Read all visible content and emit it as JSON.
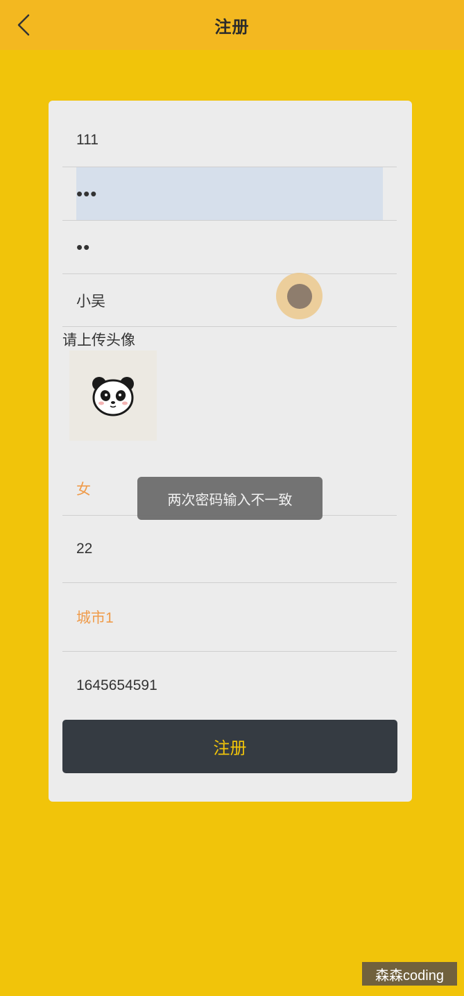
{
  "header": {
    "title": "注册",
    "back_icon": "chevron-left-icon"
  },
  "form": {
    "username": "111",
    "password": "•••",
    "confirm_password": "••",
    "nickname": "小吴",
    "avatar_label": "请上传头像",
    "avatar_icon": "panda-avatar-icon",
    "gender": "女",
    "age": "22",
    "city": "城市1",
    "phone": "1645654591",
    "submit_label": "注册"
  },
  "toast": {
    "message": "两次密码输入不一致"
  },
  "watermark": "森森coding",
  "colors": {
    "background": "#f1c40a",
    "header": "#f3b820",
    "card": "#ececec",
    "button": "#353b42",
    "button_text": "#f1c40a",
    "picker_text": "#ef9b4a"
  }
}
